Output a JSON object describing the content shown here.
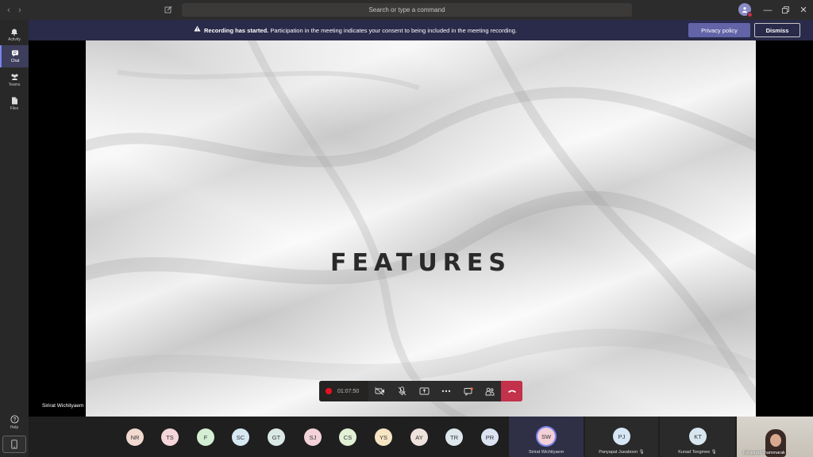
{
  "titlebar": {
    "search_placeholder": "Search or type a command"
  },
  "rail": {
    "items": [
      {
        "label": "Activity",
        "icon": "bell-icon"
      },
      {
        "label": "Chat",
        "icon": "chat-icon"
      },
      {
        "label": "Teams",
        "icon": "teams-icon"
      },
      {
        "label": "Files",
        "icon": "files-icon"
      }
    ],
    "help_label": "Help"
  },
  "banner": {
    "strong": "Recording has started.",
    "text": " Participation in the meeting indicates your consent to being included in the meeting recording.",
    "privacy_button": "Privacy policy",
    "dismiss_button": "Dismiss"
  },
  "slide": {
    "title": "FEATURES",
    "presenter": "Sirirat Wichityaem"
  },
  "controls": {
    "timer": "01:07:50",
    "recording_color": "#e81123",
    "hangup_color": "#c4314b"
  },
  "participants": {
    "avatars": [
      {
        "initials": "NR",
        "color": "#f1d9d0"
      },
      {
        "initials": "TS",
        "color": "#f4d6db"
      },
      {
        "initials": "F",
        "color": "#d4eed3"
      },
      {
        "initials": "SC",
        "color": "#d6e9f2"
      },
      {
        "initials": "GT",
        "color": "#dbe9e6"
      },
      {
        "initials": "SJ",
        "color": "#f3d3d9"
      },
      {
        "initials": "CS",
        "color": "#e2f0d4"
      },
      {
        "initials": "YS",
        "color": "#f6e5c3"
      },
      {
        "initials": "AY",
        "color": "#efe1dc"
      },
      {
        "initials": "TR",
        "color": "#dde7ec"
      },
      {
        "initials": "PR",
        "color": "#dce3f3"
      }
    ],
    "tiles": [
      {
        "initials": "SW",
        "name": "Sirirat Wichityaem",
        "color": "#f3cfd8"
      },
      {
        "initials": "PJ",
        "name": "Panyapat Jueaboon",
        "color": "#d6e6f4"
      },
      {
        "initials": "KT",
        "name": "Kunad Tongmee",
        "color": "#d8e7ef"
      }
    ],
    "video_name": "Kanyarat Thammarak"
  }
}
